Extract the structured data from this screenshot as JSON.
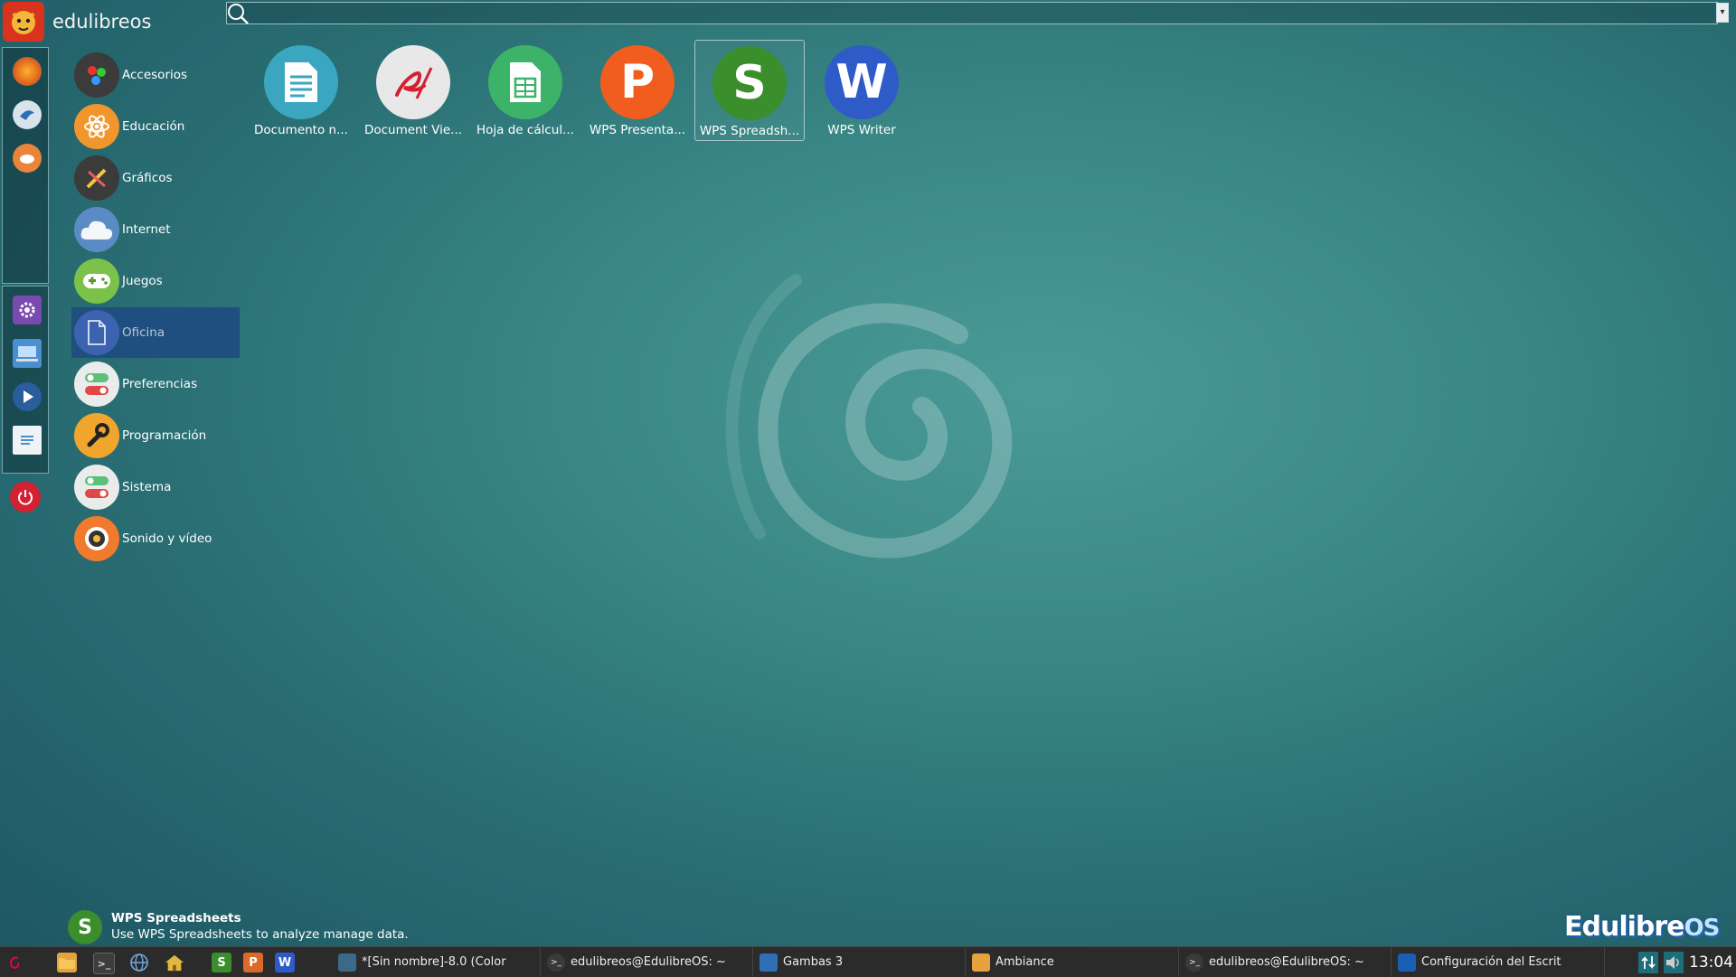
{
  "menu": {
    "user": "edulibreos",
    "search": {
      "value": "",
      "placeholder": ""
    }
  },
  "categories": [
    {
      "label": "Accesorios",
      "color": "#3b3b3b"
    },
    {
      "label": "Educación",
      "color": "#f0962d"
    },
    {
      "label": "Gráficos",
      "color": "#3b3b3b"
    },
    {
      "label": "Internet",
      "color": "#5b8bc4"
    },
    {
      "label": "Juegos",
      "color": "#7bc24a"
    },
    {
      "label": "Oficina",
      "color": "#3b63b0",
      "selected": true
    },
    {
      "label": "Preferencias",
      "color": "#e9ecea"
    },
    {
      "label": "Programación",
      "color": "#f0a62d"
    },
    {
      "label": "Sistema",
      "color": "#e9ecea"
    },
    {
      "label": "Sonido y vídeo",
      "color": "#f07a2d"
    }
  ],
  "apps": [
    {
      "label": "Documento n...",
      "icon": "document-icon",
      "color": "#3aa6bf"
    },
    {
      "label": "Document Vie...",
      "icon": "document-viewer-icon",
      "color": "#e8e8e8"
    },
    {
      "label": "Hoja de cálcul...",
      "icon": "spreadsheet-icon",
      "color": "#3db36a"
    },
    {
      "label": "WPS Presenta...",
      "icon": "wps-presentation-icon",
      "color": "#f05d1e",
      "letter": "P"
    },
    {
      "label": "WPS Spreadsh...",
      "icon": "wps-spreadsheets-icon",
      "color": "#3a8e2c",
      "letter": "S",
      "focused": true
    },
    {
      "label": "WPS Writer",
      "icon": "wps-writer-icon",
      "color": "#2e5bc7",
      "letter": "W"
    }
  ],
  "description": {
    "title": "WPS Spreadsheets",
    "text": "Use WPS Spreadsheets to analyze manage data."
  },
  "brand": "Edulibre",
  "taskbar": {
    "tasks": [
      {
        "label": "*[Sin nombre]-8.0 (Color"
      },
      {
        "label": "edulibreos@EdulibreOS: ~"
      },
      {
        "label": "Gambas 3"
      },
      {
        "label": "Ambiance"
      },
      {
        "label": "edulibreos@EdulibreOS: ~"
      },
      {
        "label": "Configuración del Escrit"
      }
    ],
    "launchers": {
      "spreadsheets": "S",
      "presentation": "P",
      "writer": "W"
    },
    "clock": "13:04"
  }
}
